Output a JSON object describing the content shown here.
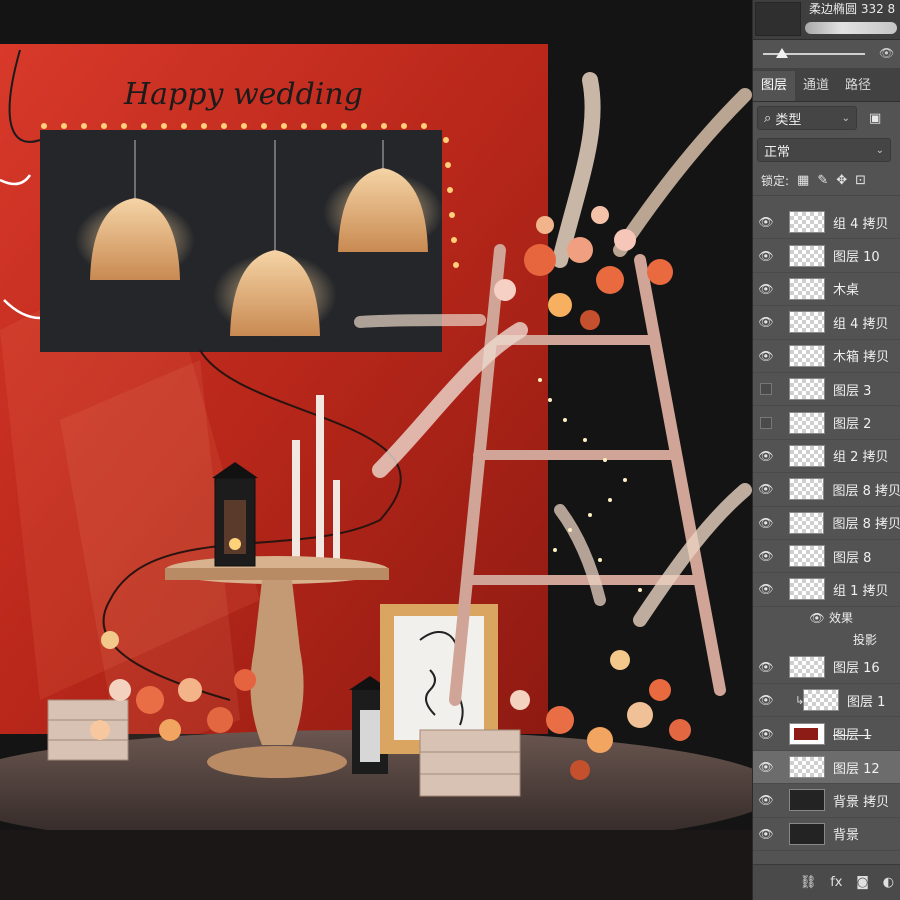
{
  "brush": {
    "name": "柔边椭圆 332 8"
  },
  "panel": {
    "tabs": [
      {
        "label": "图层"
      },
      {
        "label": "通道"
      },
      {
        "label": "路径"
      }
    ],
    "filter_label": "类型",
    "blend_mode": "正常",
    "lock_label": "锁定:",
    "layers": [
      {
        "name": "组 4 拷贝",
        "visible": true
      },
      {
        "name": "图层 10",
        "visible": true
      },
      {
        "name": "木桌",
        "visible": true
      },
      {
        "name": "组 4 拷贝",
        "visible": true
      },
      {
        "name": "木箱 拷贝",
        "visible": true
      },
      {
        "name": "图层 3",
        "visible": false
      },
      {
        "name": "图层 2",
        "visible": false
      },
      {
        "name": "组 2 拷贝",
        "visible": true
      },
      {
        "name": "图层 8 拷贝",
        "visible": true
      },
      {
        "name": "图层 8 拷贝",
        "visible": true
      },
      {
        "name": "图层 8",
        "visible": true
      },
      {
        "name": "组 1 拷贝",
        "visible": true
      }
    ],
    "effects_label": "效果",
    "effect_name": "投影",
    "layers_after": [
      {
        "name": "图层 16",
        "visible": true
      },
      {
        "name": "图层 1",
        "visible": true,
        "clipped": true
      },
      {
        "name": "图层 1",
        "visible": true
      },
      {
        "name": "图层 12",
        "visible": true,
        "selected": true
      },
      {
        "name": "背景 拷贝",
        "visible": true
      },
      {
        "name": "背景",
        "visible": true
      }
    ],
    "footer": {
      "fx": "fx"
    }
  },
  "canvas": {
    "headline": "Happy wedding",
    "colors": {
      "wall": "#c9301f",
      "board": "#222426",
      "floor": "#5a4a44"
    }
  }
}
